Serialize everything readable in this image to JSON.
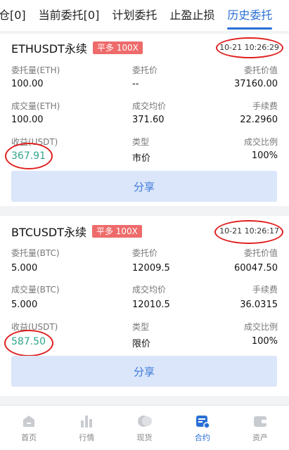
{
  "tabs": [
    "仓[0]",
    "当前委托[0]",
    "计划委托",
    "止盈止损",
    "历史委托"
  ],
  "orders": [
    {
      "symbol": "ETHUSDT永续",
      "badge": "平多 100X",
      "time": "10-21 10:26:29",
      "entrust_qty_label": "委托量(ETH)",
      "entrust_qty": "100.00",
      "entrust_price_label": "委托价",
      "entrust_price": "--",
      "entrust_value_label": "委托价值",
      "entrust_value": "37160.00",
      "filled_qty_label": "成交量(ETH)",
      "filled_qty": "100.00",
      "avg_price_label": "成交均价",
      "avg_price": "371.60",
      "fee_label": "手续费",
      "fee": "22.2960",
      "pnl_label": "收益(USDT)",
      "pnl": "367.91",
      "type_label": "类型",
      "type": "市价",
      "ratio_label": "成交比例",
      "ratio": "100%",
      "share": "分享"
    },
    {
      "symbol": "BTCUSDT永续",
      "badge": "平多 100X",
      "time": "10-21 10:26:17",
      "entrust_qty_label": "委托量(BTC)",
      "entrust_qty": "5.000",
      "entrust_price_label": "委托价",
      "entrust_price": "12009.5",
      "entrust_value_label": "委托价值",
      "entrust_value": "60047.50",
      "filled_qty_label": "成交量(BTC)",
      "filled_qty": "5.000",
      "avg_price_label": "成交均价",
      "avg_price": "12010.5",
      "fee_label": "手续费",
      "fee": "36.0315",
      "pnl_label": "收益(USDT)",
      "pnl": "587.50",
      "type_label": "类型",
      "type": "限价",
      "ratio_label": "成交比例",
      "ratio": "100%",
      "share": "分享"
    }
  ],
  "nav": [
    {
      "label": "首页",
      "icon": "home-icon"
    },
    {
      "label": "行情",
      "icon": "market-chart-icon"
    },
    {
      "label": "现货",
      "icon": "spot-coins-icon"
    },
    {
      "label": "合约",
      "icon": "contract-icon",
      "active": true
    },
    {
      "label": "资产",
      "icon": "wallet-icon"
    }
  ],
  "colors": {
    "accent": "#2a6fd6",
    "profit": "#2ea58a",
    "badge": "#ee6b6b",
    "annotation": "#e01f1f"
  }
}
